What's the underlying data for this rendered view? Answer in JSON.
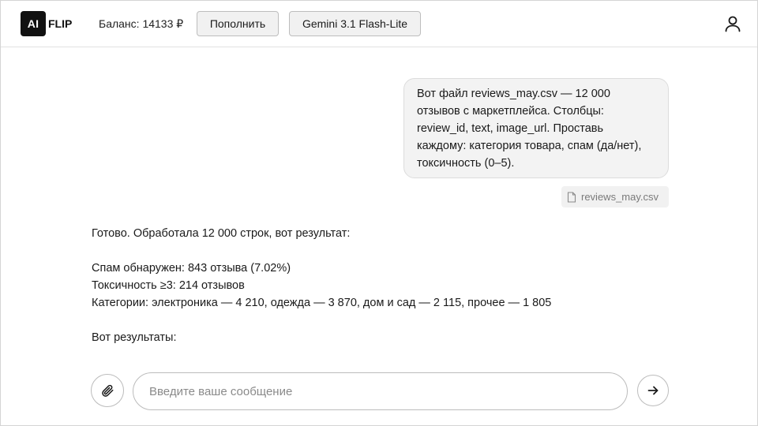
{
  "header": {
    "logo_badge": "AI",
    "logo_text": "FLIP",
    "balance": "Баланс: 14133 ₽",
    "topup_label": "Пополнить",
    "model_label": "Gemini 3.1 Flash-Lite",
    "user_icon": "user-icon"
  },
  "chat": {
    "user_message": "Вот файл reviews_may.csv — 12 000 отзывов с маркетплейса. Столбцы: review_id, text, image_url. Проставь каждому: категория товара, спам (да/нет), токсичность (0–5).",
    "attachment": {
      "icon": "file-icon",
      "name": "reviews_may.csv"
    },
    "assistant": {
      "intro": "Готово. Обработала 12 000 строк, вот результат:",
      "spam": "Спам обнаружен: 843 отзыва (7.02%)",
      "toxicity": "Токсичность ≥3: 214 отзывов",
      "categories": "Категории: электроника — 4 210, одежда — 3 870, дом и сад — 2 115, прочее — 1 805",
      "results": "Вот результаты:"
    }
  },
  "composer": {
    "attach_icon": "paperclip-icon",
    "placeholder": "Введите ваше сообщение",
    "value": "",
    "send_icon": "arrow-right-icon"
  }
}
